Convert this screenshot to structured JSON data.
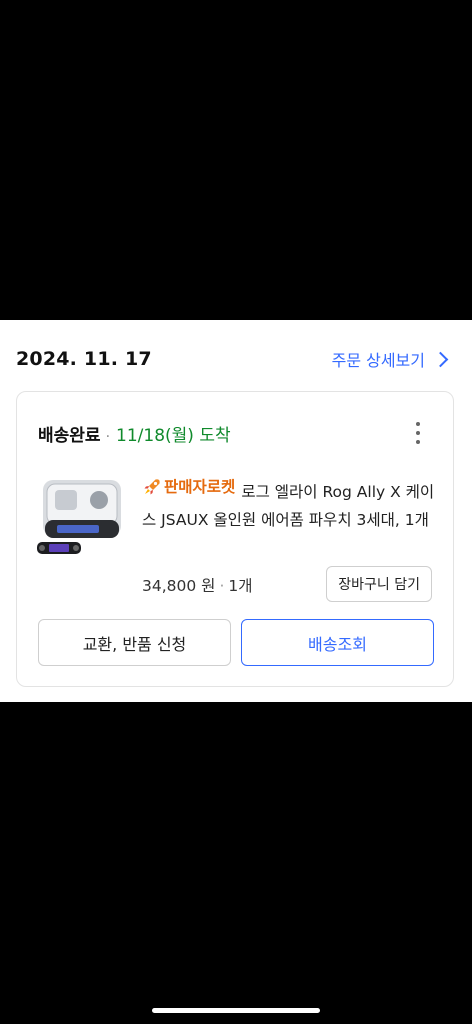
{
  "order": {
    "date": "2024. 11. 17",
    "detail_link": "주문 상세보기"
  },
  "shipment": {
    "status": "배송완료",
    "separator": "·",
    "arrival": "11/18(월) 도착"
  },
  "product": {
    "badge": "판매자로켓",
    "name": "로그 엘라이 Rog Ally X 케이스 JSAUX 올인원 에어폼 파우치 3세대, 1개",
    "price": "34,800 원",
    "separator": "·",
    "quantity": "1개"
  },
  "buttons": {
    "add_to_cart": "장바구니 담기",
    "exchange_return": "교환, 반품 신청",
    "track_delivery": "배송조회"
  },
  "colors": {
    "accent_blue": "#346aff",
    "arrival_green": "#108a2c",
    "badge_orange": "#e56a0e"
  },
  "icons": [
    "chevron-right-icon",
    "more-vertical-icon",
    "rocket-icon"
  ]
}
